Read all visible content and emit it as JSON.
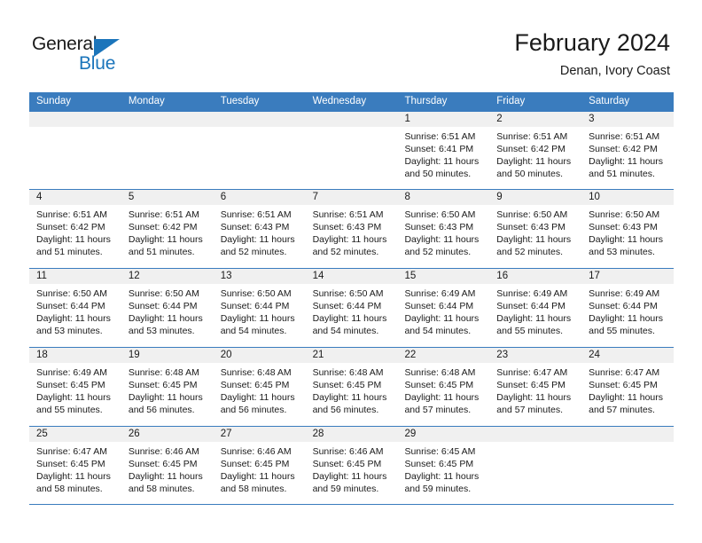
{
  "logo": {
    "word_top": "General",
    "word_bottom": "Blue",
    "triangle_color": "#1b75bb",
    "top_color": "#1a1a1a"
  },
  "header": {
    "title": "February 2024",
    "subtitle": "Denan, Ivory Coast"
  },
  "theme": {
    "header_blue": "#3a7cbe",
    "day_number_band": "#f0f0f0",
    "text": "#1a1a1a"
  },
  "day_headers": [
    "Sunday",
    "Monday",
    "Tuesday",
    "Wednesday",
    "Thursday",
    "Friday",
    "Saturday"
  ],
  "weeks": [
    [
      {
        "date": "",
        "lines": []
      },
      {
        "date": "",
        "lines": []
      },
      {
        "date": "",
        "lines": []
      },
      {
        "date": "",
        "lines": []
      },
      {
        "date": "1",
        "lines": [
          "Sunrise: 6:51 AM",
          "Sunset: 6:41 PM",
          "Daylight: 11 hours",
          "and 50 minutes."
        ]
      },
      {
        "date": "2",
        "lines": [
          "Sunrise: 6:51 AM",
          "Sunset: 6:42 PM",
          "Daylight: 11 hours",
          "and 50 minutes."
        ]
      },
      {
        "date": "3",
        "lines": [
          "Sunrise: 6:51 AM",
          "Sunset: 6:42 PM",
          "Daylight: 11 hours",
          "and 51 minutes."
        ]
      }
    ],
    [
      {
        "date": "4",
        "lines": [
          "Sunrise: 6:51 AM",
          "Sunset: 6:42 PM",
          "Daylight: 11 hours",
          "and 51 minutes."
        ]
      },
      {
        "date": "5",
        "lines": [
          "Sunrise: 6:51 AM",
          "Sunset: 6:42 PM",
          "Daylight: 11 hours",
          "and 51 minutes."
        ]
      },
      {
        "date": "6",
        "lines": [
          "Sunrise: 6:51 AM",
          "Sunset: 6:43 PM",
          "Daylight: 11 hours",
          "and 52 minutes."
        ]
      },
      {
        "date": "7",
        "lines": [
          "Sunrise: 6:51 AM",
          "Sunset: 6:43 PM",
          "Daylight: 11 hours",
          "and 52 minutes."
        ]
      },
      {
        "date": "8",
        "lines": [
          "Sunrise: 6:50 AM",
          "Sunset: 6:43 PM",
          "Daylight: 11 hours",
          "and 52 minutes."
        ]
      },
      {
        "date": "9",
        "lines": [
          "Sunrise: 6:50 AM",
          "Sunset: 6:43 PM",
          "Daylight: 11 hours",
          "and 52 minutes."
        ]
      },
      {
        "date": "10",
        "lines": [
          "Sunrise: 6:50 AM",
          "Sunset: 6:43 PM",
          "Daylight: 11 hours",
          "and 53 minutes."
        ]
      }
    ],
    [
      {
        "date": "11",
        "lines": [
          "Sunrise: 6:50 AM",
          "Sunset: 6:44 PM",
          "Daylight: 11 hours",
          "and 53 minutes."
        ]
      },
      {
        "date": "12",
        "lines": [
          "Sunrise: 6:50 AM",
          "Sunset: 6:44 PM",
          "Daylight: 11 hours",
          "and 53 minutes."
        ]
      },
      {
        "date": "13",
        "lines": [
          "Sunrise: 6:50 AM",
          "Sunset: 6:44 PM",
          "Daylight: 11 hours",
          "and 54 minutes."
        ]
      },
      {
        "date": "14",
        "lines": [
          "Sunrise: 6:50 AM",
          "Sunset: 6:44 PM",
          "Daylight: 11 hours",
          "and 54 minutes."
        ]
      },
      {
        "date": "15",
        "lines": [
          "Sunrise: 6:49 AM",
          "Sunset: 6:44 PM",
          "Daylight: 11 hours",
          "and 54 minutes."
        ]
      },
      {
        "date": "16",
        "lines": [
          "Sunrise: 6:49 AM",
          "Sunset: 6:44 PM",
          "Daylight: 11 hours",
          "and 55 minutes."
        ]
      },
      {
        "date": "17",
        "lines": [
          "Sunrise: 6:49 AM",
          "Sunset: 6:44 PM",
          "Daylight: 11 hours",
          "and 55 minutes."
        ]
      }
    ],
    [
      {
        "date": "18",
        "lines": [
          "Sunrise: 6:49 AM",
          "Sunset: 6:45 PM",
          "Daylight: 11 hours",
          "and 55 minutes."
        ]
      },
      {
        "date": "19",
        "lines": [
          "Sunrise: 6:48 AM",
          "Sunset: 6:45 PM",
          "Daylight: 11 hours",
          "and 56 minutes."
        ]
      },
      {
        "date": "20",
        "lines": [
          "Sunrise: 6:48 AM",
          "Sunset: 6:45 PM",
          "Daylight: 11 hours",
          "and 56 minutes."
        ]
      },
      {
        "date": "21",
        "lines": [
          "Sunrise: 6:48 AM",
          "Sunset: 6:45 PM",
          "Daylight: 11 hours",
          "and 56 minutes."
        ]
      },
      {
        "date": "22",
        "lines": [
          "Sunrise: 6:48 AM",
          "Sunset: 6:45 PM",
          "Daylight: 11 hours",
          "and 57 minutes."
        ]
      },
      {
        "date": "23",
        "lines": [
          "Sunrise: 6:47 AM",
          "Sunset: 6:45 PM",
          "Daylight: 11 hours",
          "and 57 minutes."
        ]
      },
      {
        "date": "24",
        "lines": [
          "Sunrise: 6:47 AM",
          "Sunset: 6:45 PM",
          "Daylight: 11 hours",
          "and 57 minutes."
        ]
      }
    ],
    [
      {
        "date": "25",
        "lines": [
          "Sunrise: 6:47 AM",
          "Sunset: 6:45 PM",
          "Daylight: 11 hours",
          "and 58 minutes."
        ]
      },
      {
        "date": "26",
        "lines": [
          "Sunrise: 6:46 AM",
          "Sunset: 6:45 PM",
          "Daylight: 11 hours",
          "and 58 minutes."
        ]
      },
      {
        "date": "27",
        "lines": [
          "Sunrise: 6:46 AM",
          "Sunset: 6:45 PM",
          "Daylight: 11 hours",
          "and 58 minutes."
        ]
      },
      {
        "date": "28",
        "lines": [
          "Sunrise: 6:46 AM",
          "Sunset: 6:45 PM",
          "Daylight: 11 hours",
          "and 59 minutes."
        ]
      },
      {
        "date": "29",
        "lines": [
          "Sunrise: 6:45 AM",
          "Sunset: 6:45 PM",
          "Daylight: 11 hours",
          "and 59 minutes."
        ]
      },
      {
        "date": "",
        "lines": []
      },
      {
        "date": "",
        "lines": []
      }
    ]
  ]
}
